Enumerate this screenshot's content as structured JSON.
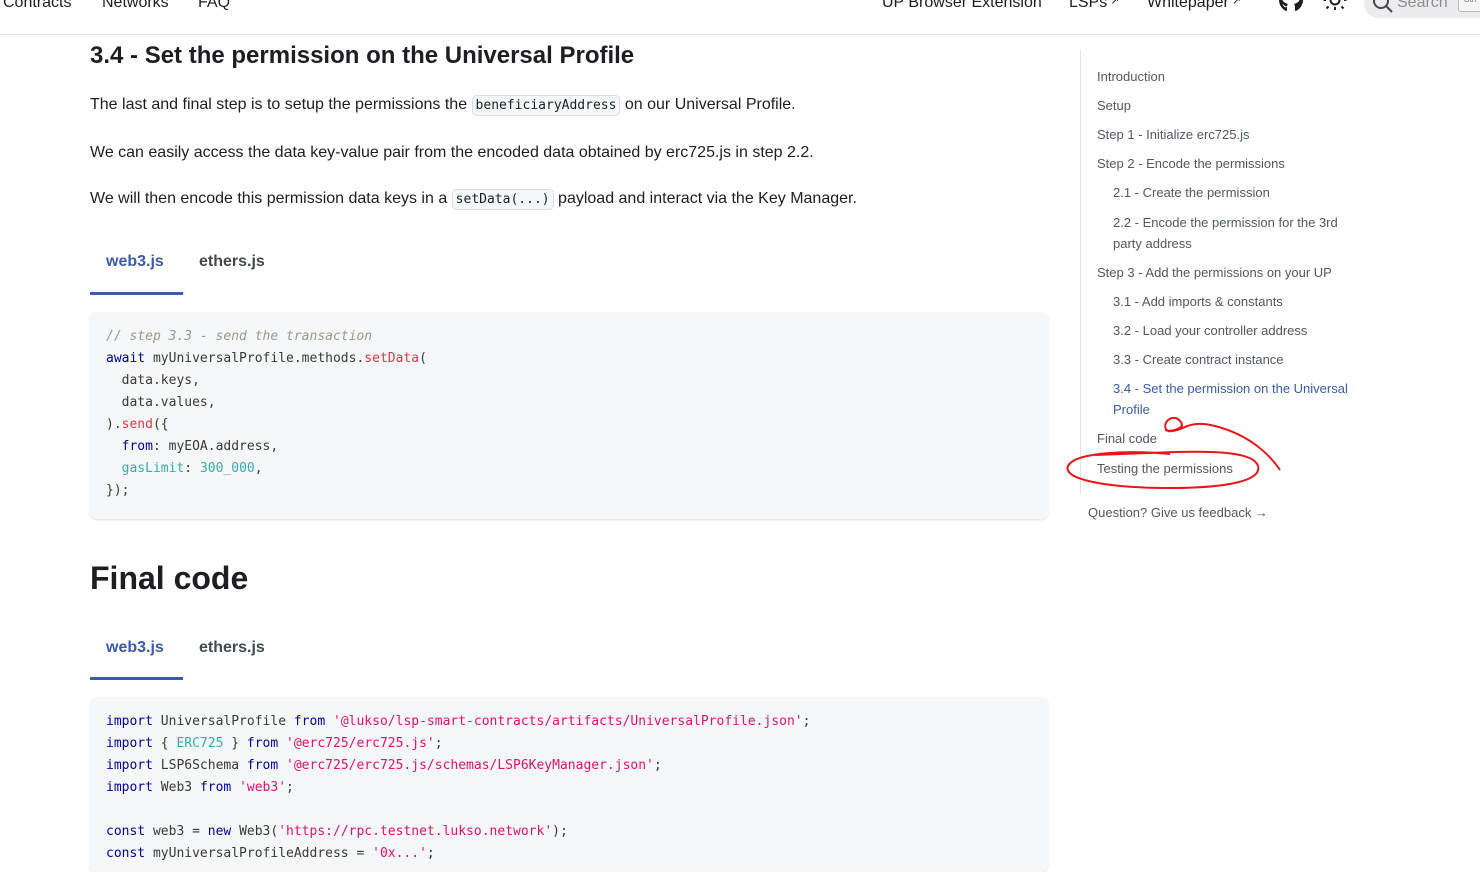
{
  "navbar": {
    "items": [
      "Contracts",
      "Networks",
      "FAQ"
    ],
    "right_items": [
      "UP Browser Extension",
      "LSPs",
      "Whitepaper"
    ],
    "search_placeholder": "Search",
    "kbd_hint": "Ctrl"
  },
  "section": {
    "title": "3.4 - Set the permission on the Universal Profile",
    "p1_before": "The last and final step is to setup the permissions the ",
    "p1_code": "beneficiaryAddress",
    "p1_after": " on our Universal Profile.",
    "p2": "We can easily access the data key-value pair from the encoded data obtained by erc725.js in step 2.2.",
    "p3_before": "We will then encode this permission data keys in a ",
    "p3_code": "setData(...)",
    "p3_after": " payload and interact via the Key Manager."
  },
  "tabs": [
    {
      "label": "web3.js",
      "active": true
    },
    {
      "label": "ethers.js",
      "active": false
    }
  ],
  "code1": [
    [
      [
        "comment",
        "// step 3.3 - send the transaction"
      ]
    ],
    [
      [
        "kw",
        "await"
      ],
      [
        "plain",
        " myUniversalProfile.methods."
      ],
      [
        "fn",
        "setData"
      ],
      [
        "plain",
        "("
      ]
    ],
    [
      [
        "plain",
        "  data.keys,"
      ]
    ],
    [
      [
        "plain",
        "  data.values,"
      ]
    ],
    [
      [
        "plain",
        ")."
      ],
      [
        "fn",
        "send"
      ],
      [
        "plain",
        "({"
      ]
    ],
    [
      [
        "plain",
        "  "
      ],
      [
        "kw",
        "from"
      ],
      [
        "plain",
        ": myEOA.address,"
      ]
    ],
    [
      [
        "plain",
        "  "
      ],
      [
        "prop",
        "gasLimit"
      ],
      [
        "plain",
        ": "
      ],
      [
        "num",
        "300_000"
      ],
      [
        "plain",
        ","
      ]
    ],
    [
      [
        "plain",
        "});"
      ]
    ]
  ],
  "final": {
    "title": "Final code"
  },
  "code2": [
    [
      [
        "kw",
        "import"
      ],
      [
        "plain",
        " UniversalProfile "
      ],
      [
        "kw",
        "from"
      ],
      [
        "plain",
        " "
      ],
      [
        "str",
        "'@lukso/lsp-smart-contracts/artifacts/UniversalProfile.json'"
      ],
      [
        "plain",
        ";"
      ]
    ],
    [
      [
        "kw",
        "import"
      ],
      [
        "plain",
        " { "
      ],
      [
        "prop",
        "ERC725"
      ],
      [
        "plain",
        " } "
      ],
      [
        "kw",
        "from"
      ],
      [
        "plain",
        " "
      ],
      [
        "str",
        "'@erc725/erc725.js'"
      ],
      [
        "plain",
        ";"
      ]
    ],
    [
      [
        "kw",
        "import"
      ],
      [
        "plain",
        " LSP6Schema "
      ],
      [
        "kw",
        "from"
      ],
      [
        "plain",
        " "
      ],
      [
        "str",
        "'@erc725/erc725.js/schemas/LSP6KeyManager.json'"
      ],
      [
        "plain",
        ";"
      ]
    ],
    [
      [
        "kw",
        "import"
      ],
      [
        "plain",
        " Web3 "
      ],
      [
        "kw",
        "from"
      ],
      [
        "plain",
        " "
      ],
      [
        "str",
        "'web3'"
      ],
      [
        "plain",
        ";"
      ]
    ],
    [
      [
        "plain",
        ""
      ]
    ],
    [
      [
        "kw",
        "const"
      ],
      [
        "plain",
        " web3 = "
      ],
      [
        "kw",
        "new"
      ],
      [
        "plain",
        " Web3("
      ],
      [
        "str",
        "'https://rpc.testnet.lukso.network'"
      ],
      [
        "plain",
        ");"
      ]
    ],
    [
      [
        "kw",
        "const"
      ],
      [
        "plain",
        " myUniversalProfileAddress = "
      ],
      [
        "str",
        "'0x...'"
      ],
      [
        "plain",
        ";"
      ]
    ]
  ],
  "toc": {
    "items": [
      {
        "label": "Introduction",
        "level": 0
      },
      {
        "label": "Setup",
        "level": 0
      },
      {
        "label": "Step 1 - Initialize erc725.js",
        "level": 0
      },
      {
        "label": "Step 2 - Encode the permissions",
        "level": 0
      },
      {
        "label": "2.1 - Create the permission",
        "level": 1
      },
      {
        "label": "2.2 - Encode the permission for the 3rd party address",
        "level": 1
      },
      {
        "label": "Step 3 - Add the permissions on your UP",
        "level": 0
      },
      {
        "label": "3.1 - Add imports & constants",
        "level": 1
      },
      {
        "label": "3.2 - Load your controller address",
        "level": 1
      },
      {
        "label": "3.3 - Create contract instance",
        "level": 1
      },
      {
        "label": "3.4 - Set the permission on the Universal Profile",
        "level": 1,
        "active": true
      },
      {
        "label": "Final code",
        "level": 0
      },
      {
        "label": "Testing the permissions",
        "level": 0
      }
    ],
    "feedback": "Question? Give us feedback →"
  },
  "colors": {
    "accent": "#3c5ba8",
    "annotation": "#e8161b"
  }
}
